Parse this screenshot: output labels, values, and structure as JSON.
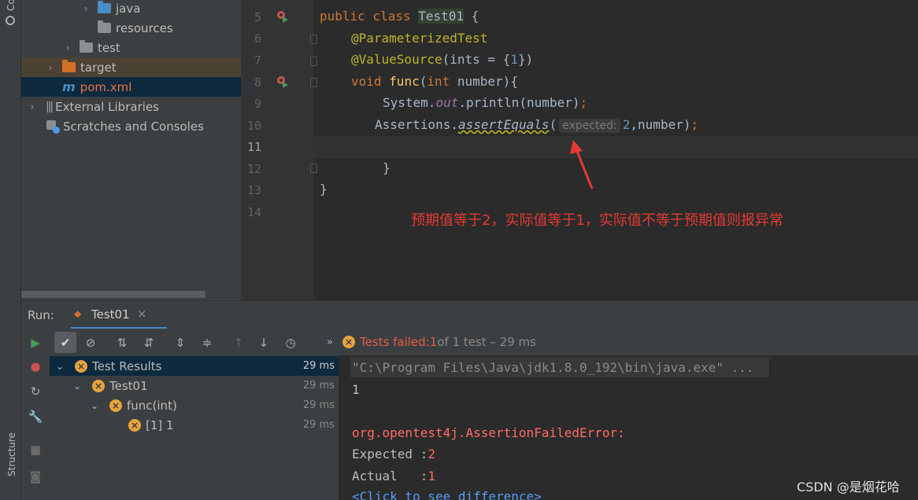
{
  "left_strip": {
    "top_label": "Co",
    "structure_label": "Structure"
  },
  "project_tree": [
    {
      "label": "java",
      "expanded": false
    },
    {
      "label": "resources"
    },
    {
      "label": "test",
      "expanded": false
    },
    {
      "label": "target",
      "expanded": false
    },
    {
      "label": "pom.xml"
    },
    {
      "label": "External Libraries",
      "expanded": false
    },
    {
      "label": "Scratches and Consoles"
    }
  ],
  "editor": {
    "line_numbers": [
      "5",
      "6",
      "7",
      "8",
      "9",
      "10",
      "11",
      "12",
      "13",
      "14"
    ],
    "code": {
      "l5_kw": "public class ",
      "l5_name": "Test01",
      "l5_rest": " {",
      "l6": "@ParameterizedTest",
      "l7_ann": "@ValueSource",
      "l7_a": "(ints = {",
      "l7_num": "1",
      "l7_b": "})",
      "l8_kw1": "void ",
      "l8_fn": "func",
      "l8_a": "(",
      "l8_kw2": "int",
      "l8_b": " number){",
      "l9_a": "System.",
      "l9_field": "out",
      "l9_b": ".println(number)",
      "l9_semi": ";",
      "l10_a": "Assertions.",
      "l10_method": "assertEquals",
      "l10_paren": "(",
      "l10_hint": "expected:",
      "l10_num": "2",
      "l10_b": ",number)",
      "l10_semi": ";",
      "l12": "}",
      "l13": "}"
    },
    "annotation_note": "预期值等于2，实际值等于1，实际值不等于预期值则报异常"
  },
  "run_panel": {
    "run_label": "Run:",
    "tab_label": "Test01",
    "status_prefix": "Tests failed: ",
    "status_failed": "1",
    "status_suffix": " of 1 test – 29 ms",
    "results": [
      {
        "label": "Test Results",
        "time": "29 ms"
      },
      {
        "label": "Test01",
        "time": "29 ms"
      },
      {
        "label": "func(int)",
        "time": "29 ms"
      },
      {
        "label": "[1] 1",
        "time": "29 ms"
      }
    ],
    "console": {
      "cmd": "\"C:\\Program Files\\Java\\jdk1.8.0_192\\bin\\java.exe\" ...",
      "out1": "1",
      "error": "org.opentest4j.AssertionFailedError:",
      "expected_label": "Expected :",
      "expected_value": "2",
      "actual_label": "Actual   :",
      "actual_value": "1",
      "diff_link": "<Click to see difference>"
    }
  },
  "watermark": "CSDN @是烟花哈"
}
